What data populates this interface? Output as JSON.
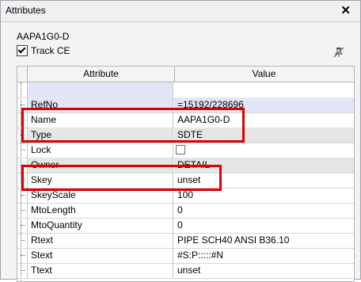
{
  "panel": {
    "title": "Attributes",
    "close_glyph": "✕",
    "element_name": "AAPA1G0-D",
    "track_ce": {
      "label": "Track CE",
      "checked": true
    },
    "pin_icon": "pin-off-icon"
  },
  "grid": {
    "columns": {
      "attribute": "Attribute",
      "value": "Value"
    },
    "rows": [
      {
        "attribute": "",
        "value": ""
      },
      {
        "attribute": "RefNo",
        "value": "=15192/228696"
      },
      {
        "attribute": "Name",
        "value": "AAPA1G0-D"
      },
      {
        "attribute": "Type",
        "value": "SDTE"
      },
      {
        "attribute": "Lock",
        "value": "",
        "checkbox": true,
        "checked": false
      },
      {
        "attribute": "Owner",
        "value": "DETAIL"
      },
      {
        "attribute": "Skey",
        "value": "unset"
      },
      {
        "attribute": "SkeyScale",
        "value": "100"
      },
      {
        "attribute": "MtoLength",
        "value": "0"
      },
      {
        "attribute": "MtoQuantity",
        "value": "0"
      },
      {
        "attribute": "Rtext",
        "value": "PIPE SCH40 ANSI B36.10"
      },
      {
        "attribute": "Stext",
        "value": "#S:P:::::#N"
      },
      {
        "attribute": "Ttext",
        "value": "unset"
      }
    ]
  },
  "colors": {
    "highlight": "#e00000",
    "selected_row": "#e3e6f7",
    "grey_row": "#e6e6e6"
  }
}
